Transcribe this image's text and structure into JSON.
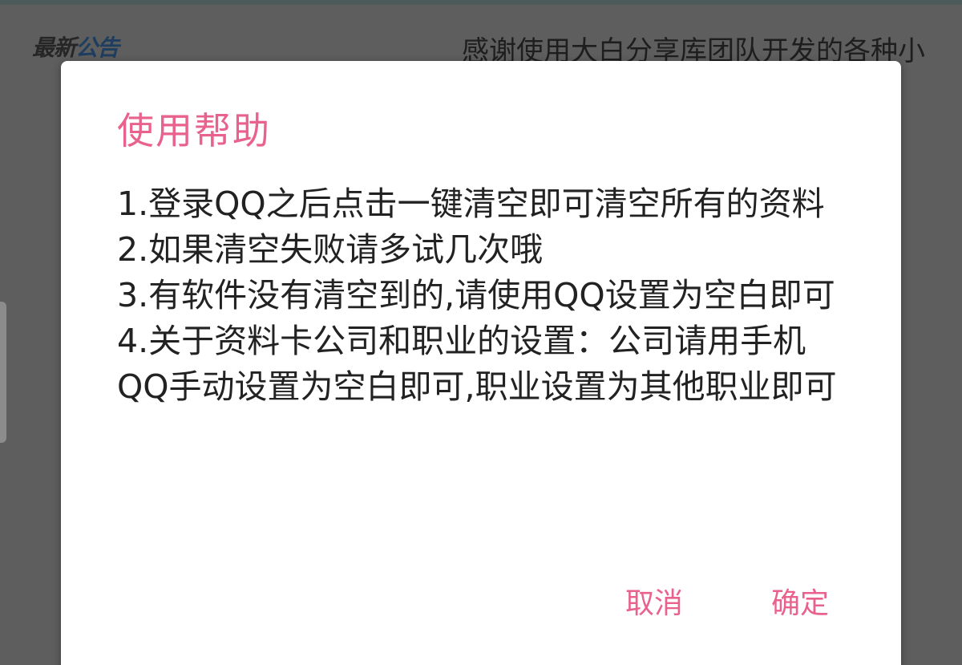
{
  "notice": {
    "label_part1": "最新",
    "label_part2": "公告",
    "marquee_text": "感谢使用大白分享库团队开发的各种小"
  },
  "dialog": {
    "title": "使用帮助",
    "lines": [
      "1.登录QQ之后点击一键清空即可清空所有的资料",
      "2.如果清空失败请多试几次哦",
      "3.有软件没有清空到的,请使用QQ设置为空白即可",
      "4.关于资料卡公司和职业的设置：公司请用手机QQ手动设置为空白即可,职业设置为其他职业即可"
    ],
    "cancel_label": "取消",
    "ok_label": "确定"
  },
  "colors": {
    "accent": "#e8628d",
    "overlay": "#5e5e5e",
    "dialog_bg": "#ffffff"
  }
}
